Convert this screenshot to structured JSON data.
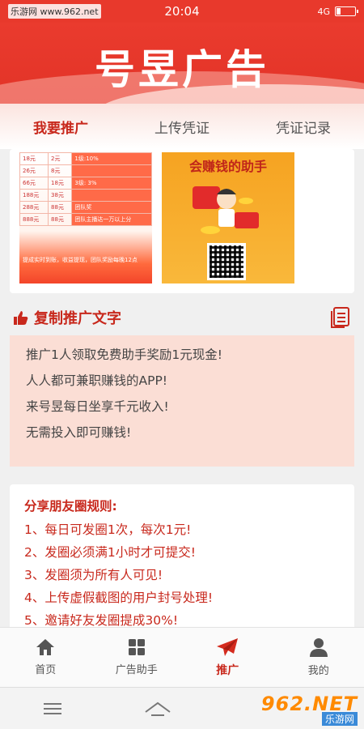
{
  "status_bar": {
    "watermark": "乐游网 www.962.net",
    "time": "20:04",
    "network": "4G",
    "battery_level": 0.2
  },
  "header": {
    "title": "号昱广告"
  },
  "tabs": [
    {
      "label": "我要推广",
      "active": true
    },
    {
      "label": "上传凭证",
      "active": false
    },
    {
      "label": "凭证记录",
      "active": false
    }
  ],
  "poster1": {
    "rows": [
      [
        "18元",
        "2元",
        "1级:10%"
      ],
      [
        "26元",
        "8元",
        ""
      ],
      [
        "66元",
        "18元",
        "3级: 3%"
      ],
      [
        "188元",
        "38元",
        ""
      ],
      [
        "288元",
        "88元",
        "团队奖"
      ],
      [
        "888元",
        "88元",
        "团队主播达一万以上分"
      ]
    ],
    "footer": "提成实时到账，收益提现，团队奖励每晚12点"
  },
  "poster2": {
    "title": "会赚钱的助手"
  },
  "copy_section": {
    "label": "复制推广文字",
    "lines": [
      "推广1人领取免费助手奖励1元现金!",
      "人人都可兼职赚钱的APP!",
      "来号昱每日坐享千元收入!",
      "无需投入即可赚钱!"
    ]
  },
  "rules": {
    "title": "分享朋友圈规则:",
    "items": [
      "1、每日可发圈1次，每次1元!",
      "2、发圈必须满1小时才可提交!",
      "3、发圈须为所有人可见!",
      "4、上传虚假截图的用户封号处理!",
      "5、邀请好友发圈提成30%!"
    ]
  },
  "bottom_nav": [
    {
      "label": "首页",
      "icon": "home-icon",
      "active": false
    },
    {
      "label": "广告助手",
      "icon": "grid-icon",
      "active": false
    },
    {
      "label": "推广",
      "icon": "paper-plane-icon",
      "active": true
    },
    {
      "label": "我的",
      "icon": "user-icon",
      "active": false
    }
  ],
  "watermark_logo": {
    "number": "962.NET",
    "text": "乐游网"
  },
  "colors": {
    "brand_red": "#e8392c",
    "accent_red": "#c8281c",
    "promo_bg": "#fbded5"
  }
}
